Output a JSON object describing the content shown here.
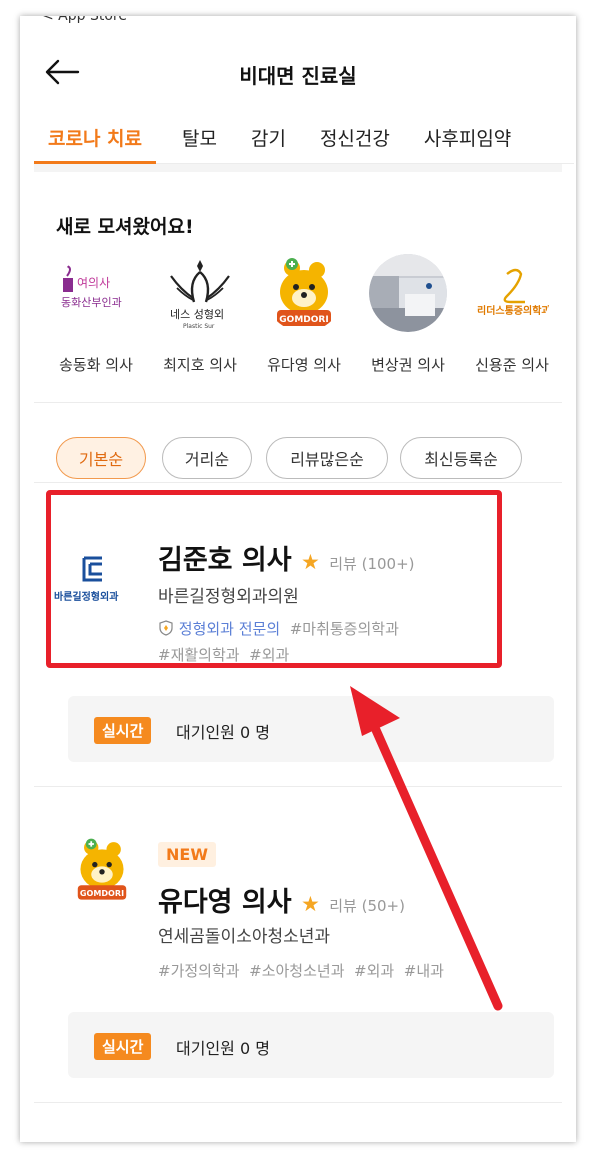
{
  "status_bar": {
    "back_app": "< App Store"
  },
  "header": {
    "title": "비대면 진료실"
  },
  "tabs": [
    "코로나 치료",
    "탈모",
    "감기",
    "정신건강",
    "사후피임약"
  ],
  "new_section": {
    "title": "새로 모셔왔어요!",
    "doctors": [
      {
        "name": "송동화 의사",
        "logo_line1": "여의사",
        "logo_line2": "동화산부인과"
      },
      {
        "name": "최지호 의사",
        "logo_text": "네스 성형외",
        "logo_sub": "Plastic Sur"
      },
      {
        "name": "유다영 의사",
        "logo_text": "GOMDORI"
      },
      {
        "name": "변상권 의사"
      },
      {
        "name": "신용준 의사",
        "logo_text": "리더스통증의학과"
      }
    ]
  },
  "sort_options": [
    "기본순",
    "거리순",
    "리뷰많은순",
    "최신등록순"
  ],
  "doctor_list": [
    {
      "name": "김준호 의사",
      "review": "리뷰 (100+)",
      "clinic": "바른길정형외과의원",
      "logo_text": "바른길정형외과",
      "specialist": "정형외과 전문의",
      "tags": [
        "#마취통증의학과",
        "#재활의학과",
        "#외과"
      ],
      "realtime_label": "실시간",
      "wait_text": "대기인원 0 명"
    },
    {
      "badge": "NEW",
      "name": "유다영 의사",
      "review": "리뷰 (50+)",
      "clinic": "연세곰돌이소아청소년과",
      "logo_text": "GOMDORI",
      "tags": [
        "#가정의학과",
        "#소아청소년과",
        "#외과",
        "#내과"
      ],
      "realtime_label": "실시간",
      "wait_text": "대기인원 0 명"
    }
  ],
  "colors": {
    "accent": "#f27a1a",
    "highlight": "#e8202a",
    "specialist": "#5b7fd6"
  }
}
